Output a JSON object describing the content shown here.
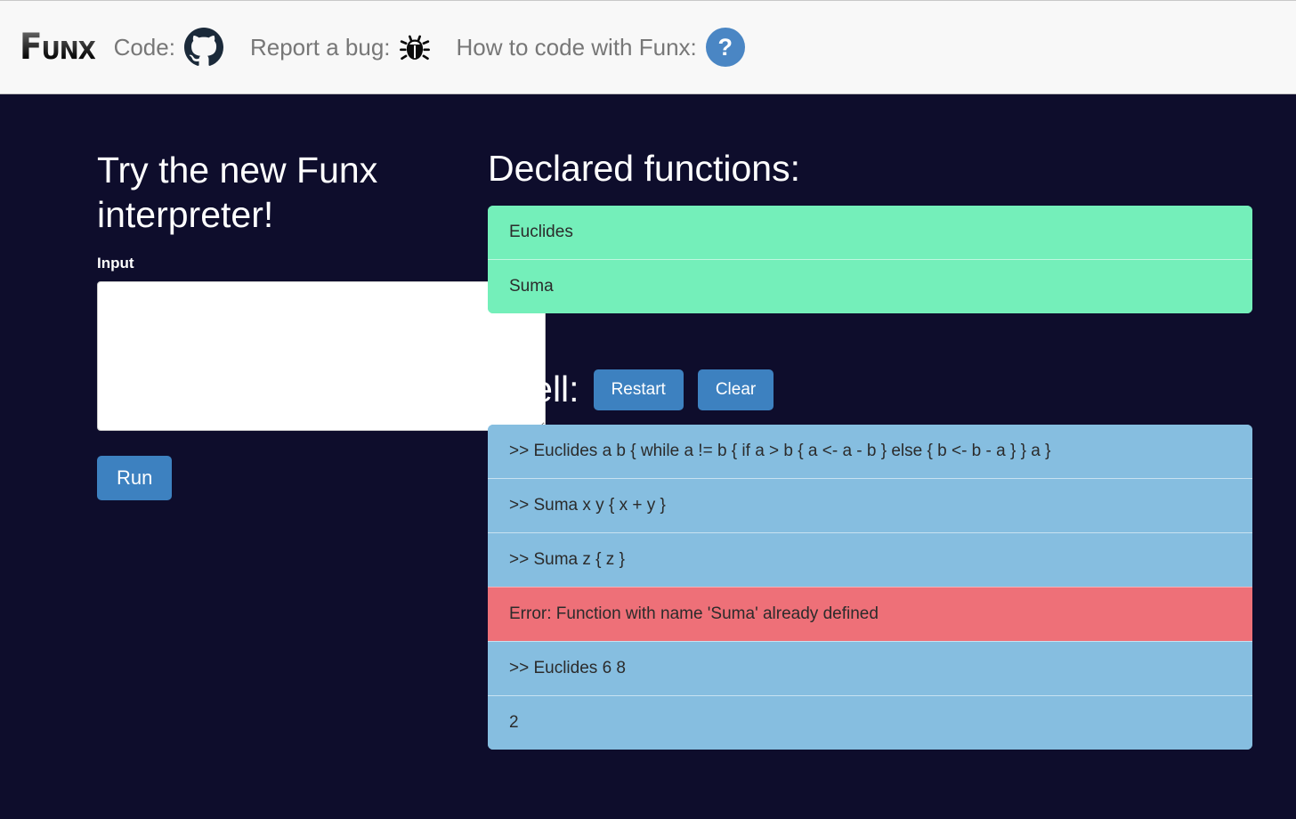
{
  "navbar": {
    "brand": "Funx",
    "items": [
      {
        "label": "Code:",
        "icon": "github-icon"
      },
      {
        "label": "Report a bug:",
        "icon": "bug-icon"
      },
      {
        "label": "How to code with Funx:",
        "icon": "help-icon",
        "glyph": "?"
      }
    ],
    "accent_blue": "#4a86c4"
  },
  "left": {
    "title": "Try the new Funx interpreter!",
    "input_label": "Input",
    "input_value": "",
    "input_placeholder": "",
    "run_label": "Run"
  },
  "right": {
    "declared_title": "Declared functions:",
    "declared_functions": [
      "Euclides",
      "Suma"
    ],
    "shell_title": "Shell:",
    "restart_label": "Restart",
    "clear_label": "Clear",
    "shell_lines": [
      {
        "text": ">> Euclides a b { while a != b { if a > b { a <- a - b } else { b <- b - a } } a }",
        "kind": "out"
      },
      {
        "text": ">> Suma x y { x + y }",
        "kind": "out"
      },
      {
        "text": ">> Suma z { z }",
        "kind": "out"
      },
      {
        "text": "Error: Function with name 'Suma' already defined",
        "kind": "err"
      },
      {
        "text": ">> Euclides 6 8",
        "kind": "out"
      },
      {
        "text": "2",
        "kind": "out"
      }
    ]
  },
  "colors": {
    "page_background": "#0e0d2c",
    "navbar_background": "#f8f8f8",
    "function_green": "#74efba",
    "shell_blue": "#86bee0",
    "error_red": "#ee7078",
    "button_blue": "#3d81c0"
  }
}
